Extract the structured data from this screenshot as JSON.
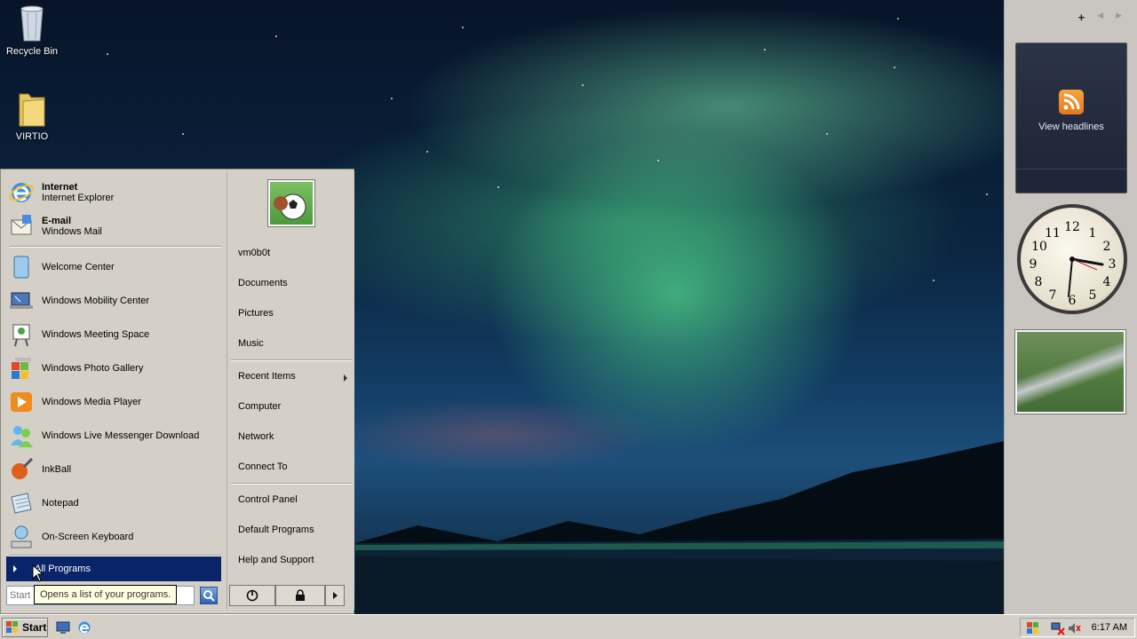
{
  "desktop": {
    "icons": [
      {
        "label": "Recycle Bin"
      },
      {
        "label": "VIRTIO"
      }
    ]
  },
  "sidebar": {
    "add_label": "+",
    "prev_label": "◀",
    "next_label": "▶",
    "rss_label": "View headlines",
    "clock_numbers": [
      "12",
      "1",
      "2",
      "3",
      "4",
      "5",
      "6",
      "7",
      "8",
      "9",
      "10",
      "11"
    ]
  },
  "start_menu": {
    "pinned": [
      {
        "title": "Internet",
        "subtitle": "Internet Explorer"
      },
      {
        "title": "E-mail",
        "subtitle": "Windows Mail"
      }
    ],
    "recent": [
      {
        "label": "Welcome Center"
      },
      {
        "label": "Windows Mobility Center"
      },
      {
        "label": "Windows Meeting Space"
      },
      {
        "label": "Windows Photo Gallery"
      },
      {
        "label": "Windows Media Player"
      },
      {
        "label": "Windows Live Messenger Download"
      },
      {
        "label": "InkBall"
      },
      {
        "label": "Notepad"
      },
      {
        "label": "On-Screen Keyboard"
      }
    ],
    "all_programs": "All Programs",
    "search_placeholder": "Start Search",
    "tooltip": "Opens a list of your programs.",
    "right": {
      "user": "vm0b0t",
      "items1": [
        "Documents",
        "Pictures",
        "Music"
      ],
      "items2": [
        "Recent Items",
        "Computer",
        "Network",
        "Connect To"
      ],
      "items3": [
        "Control Panel",
        "Default Programs",
        "Help and Support"
      ]
    }
  },
  "taskbar": {
    "start_label": "Start",
    "time": "6:17 AM"
  },
  "colors": {
    "selection": "#0a246a",
    "menu_bg": "#d4d0c8",
    "tooltip_bg": "#ffffe1"
  }
}
